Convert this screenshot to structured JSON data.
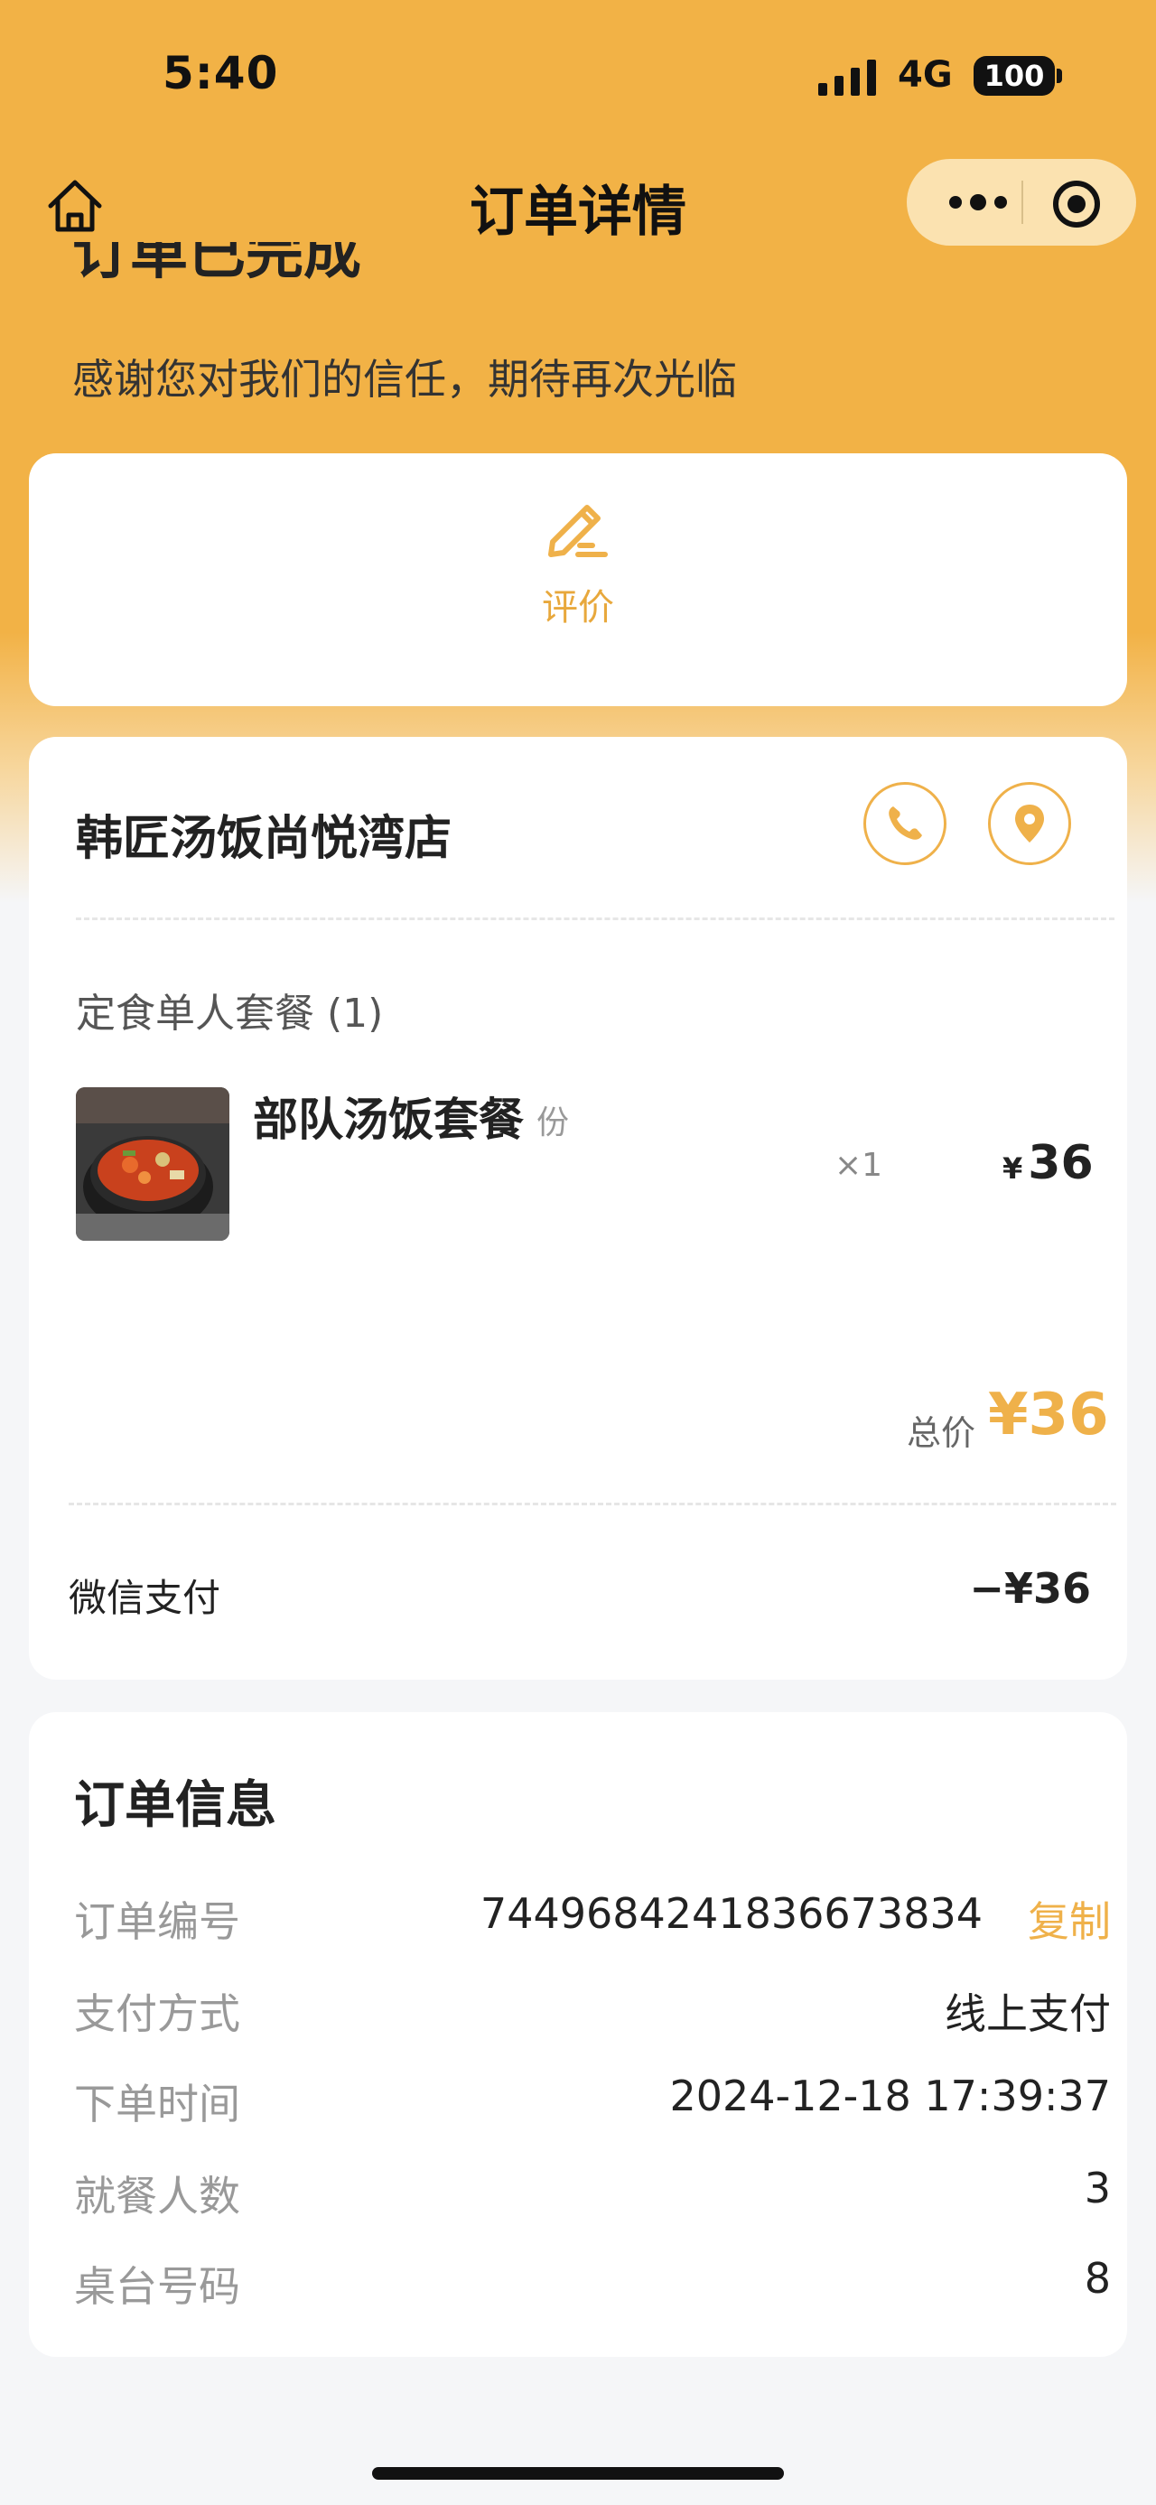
{
  "status_bar": {
    "time": "5:40",
    "network": "4G",
    "battery": "100"
  },
  "nav": {
    "title": "订单详情"
  },
  "status": {
    "title": "订单已完成",
    "subtitle": "感谢您对我们的信任，期待再次光临"
  },
  "review": {
    "label": "评价"
  },
  "store": {
    "name": "韩匠汤饭尚悦湾店"
  },
  "order": {
    "section_title": "定食单人套餐 (1)",
    "item": {
      "name": "部队汤饭套餐",
      "unit": "份",
      "qty": "×1",
      "currency": "¥",
      "price": "36"
    },
    "total_label": "总价",
    "total": "¥36",
    "payment_method_label": "微信支付",
    "payment_amount": "−¥36"
  },
  "info": {
    "title": "订单信息",
    "rows": [
      {
        "label": "订单编号",
        "value": "7449684241836673834",
        "action": "复制"
      },
      {
        "label": "支付方式",
        "value": "线上支付"
      },
      {
        "label": "下单时间",
        "value": "2024-12-18 17:39:37"
      },
      {
        "label": "就餐人数",
        "value": "3"
      },
      {
        "label": "桌台号码",
        "value": "8"
      }
    ]
  },
  "colors": {
    "accent": "#efb14a",
    "header_bg": "#f2b246",
    "page_bg": "#f5f6f8"
  }
}
